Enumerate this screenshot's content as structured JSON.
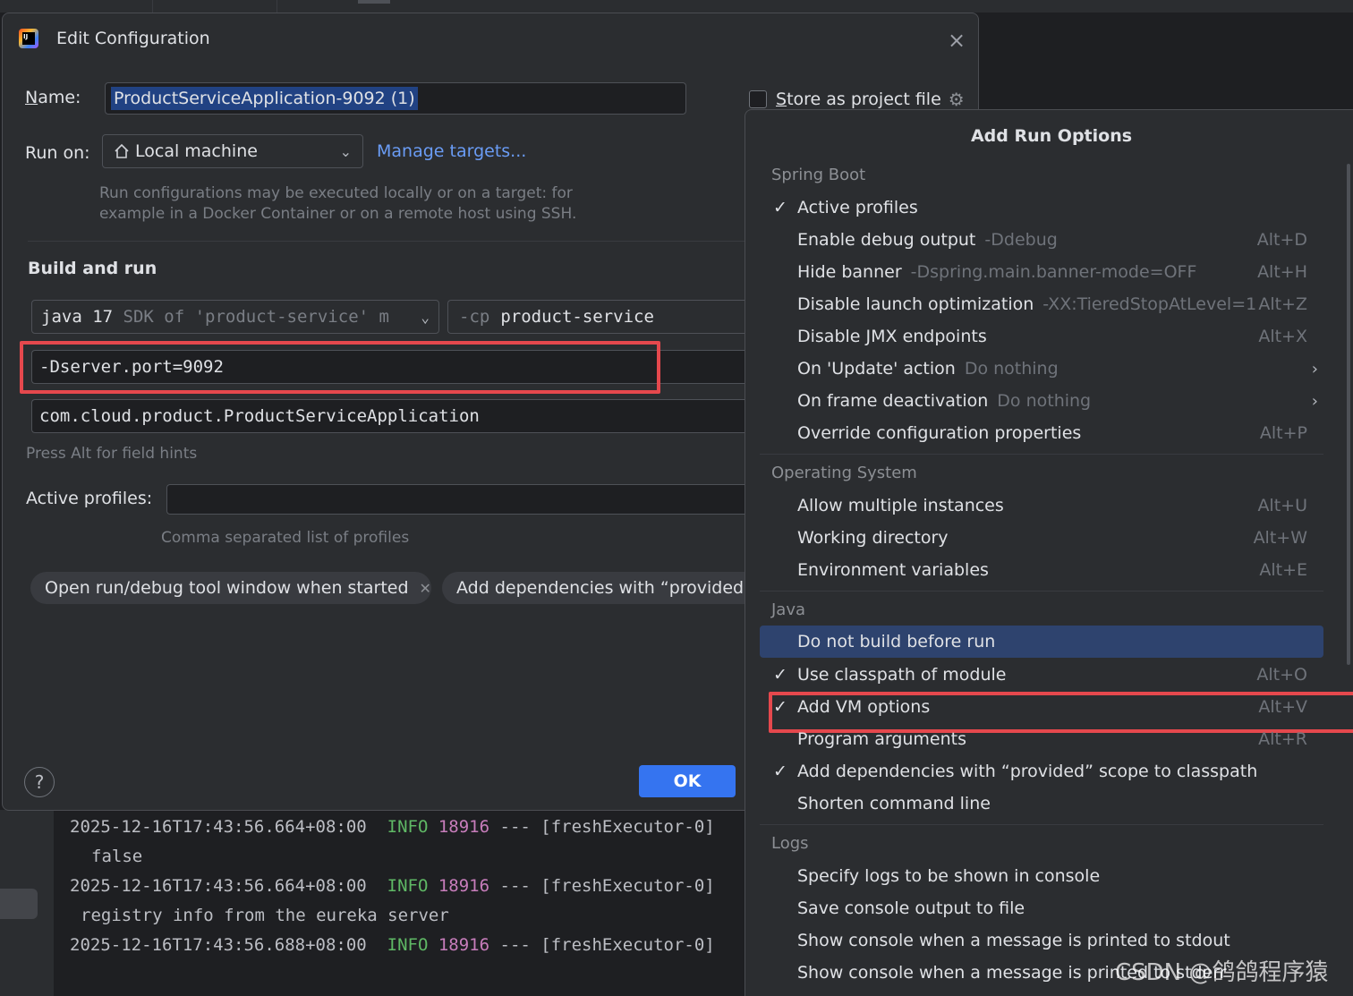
{
  "dialog": {
    "title": "Edit Configuration",
    "name_label": "Name:",
    "name_value": "ProductServiceApplication-9092 (1)",
    "store_label": "Store as project file",
    "run_on_label": "Run on:",
    "run_on_value": "Local machine",
    "manage_targets": "Manage targets...",
    "run_hint_1": "Run configurations may be executed locally or on a target: for",
    "run_hint_2": "example in a Docker Container or on a remote host using SSH.",
    "build_run": "Build and run",
    "sdk_main": "java 17",
    "sdk_dim": "SDK of 'product-service' m",
    "cp_flag": "-cp",
    "cp_value": "product-service",
    "vm_options": "-Dserver.port=9092",
    "main_class": "com.cloud.product.ProductServiceApplication",
    "alt_hint": "Press Alt for field hints",
    "profiles_label": "Active profiles:",
    "profiles_value": "",
    "profiles_hint": "Comma separated list of profiles",
    "chip1": "Open run/debug tool window when started",
    "chip2": "Add dependencies with “provided”",
    "help": "?",
    "ok": "OK"
  },
  "console": {
    "lines": [
      {
        "ts": "2025-12-16T17:43:56.664+08:00",
        "level": "INFO",
        "pid": "18916",
        "rest": "--- [freshExecutor-0]"
      },
      {
        "text": "false"
      },
      {
        "ts": "2025-12-16T17:43:56.664+08:00",
        "level": "INFO",
        "pid": "18916",
        "rest": "--- [freshExecutor-0]"
      },
      {
        "text": "registry info from the eureka server"
      },
      {
        "ts": "2025-12-16T17:43:56.688+08:00",
        "level": "INFO",
        "pid": "18916",
        "rest": "--- [freshExecutor-0]"
      }
    ]
  },
  "popup": {
    "title": "Add Run Options",
    "groups": {
      "spring": "Spring Boot",
      "os": "Operating System",
      "java": "Java",
      "logs": "Logs"
    },
    "items": [
      {
        "label": "Active profiles",
        "hint": "",
        "shortcut": "",
        "checked": "✓"
      },
      {
        "label": "Enable debug output",
        "hint": "-Ddebug",
        "shortcut": "Alt+D",
        "checked": ""
      },
      {
        "label": "Hide banner",
        "hint": "-Dspring.main.banner-mode=OFF",
        "shortcut": "Alt+H",
        "checked": ""
      },
      {
        "label": "Disable launch optimization",
        "hint": "-XX:TieredStopAtLevel=1",
        "shortcut": "Alt+Z",
        "checked": ""
      },
      {
        "label": "Disable JMX endpoints",
        "hint": "",
        "shortcut": "Alt+X",
        "checked": ""
      },
      {
        "label": "On 'Update' action",
        "hint": "Do nothing",
        "shortcut": "",
        "checked": ""
      },
      {
        "label": "On frame deactivation",
        "hint": "Do nothing",
        "shortcut": "",
        "checked": ""
      },
      {
        "label": "Override configuration properties",
        "hint": "",
        "shortcut": "Alt+P",
        "checked": ""
      },
      {
        "label": "Allow multiple instances",
        "hint": "",
        "shortcut": "Alt+U",
        "checked": ""
      },
      {
        "label": "Working directory",
        "hint": "",
        "shortcut": "Alt+W",
        "checked": ""
      },
      {
        "label": "Environment variables",
        "hint": "",
        "shortcut": "Alt+E",
        "checked": ""
      },
      {
        "label": "Do not build before run",
        "hint": "",
        "shortcut": "",
        "checked": ""
      },
      {
        "label": "Use classpath of module",
        "hint": "",
        "shortcut": "Alt+O",
        "checked": "✓"
      },
      {
        "label": "Add VM options",
        "hint": "",
        "shortcut": "Alt+V",
        "checked": "✓"
      },
      {
        "label": "Program arguments",
        "hint": "",
        "shortcut": "Alt+R",
        "checked": ""
      },
      {
        "label": "Add dependencies with “provided” scope to classpath",
        "hint": "",
        "shortcut": "",
        "checked": "✓"
      },
      {
        "label": "Shorten command line",
        "hint": "",
        "shortcut": "",
        "checked": ""
      },
      {
        "label": "Specify logs to be shown in console",
        "hint": "",
        "shortcut": "",
        "checked": ""
      },
      {
        "label": "Save console output to file",
        "hint": "",
        "shortcut": "",
        "checked": ""
      },
      {
        "label": "Show console when a message is printed to stdout",
        "hint": "",
        "shortcut": "",
        "checked": ""
      },
      {
        "label": "Show console when a message is printed to stderr",
        "hint": "",
        "shortcut": "",
        "checked": ""
      }
    ]
  },
  "watermark": "CSDN @鸽鸽程序猿",
  "colors": {
    "accent": "#3574f0",
    "link": "#6a9cf5",
    "highlight_box": "#e5484d",
    "selected_row": "#2e436e"
  }
}
